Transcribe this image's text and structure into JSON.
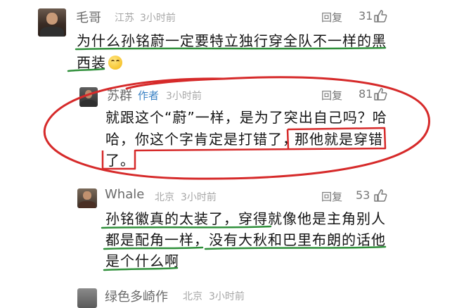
{
  "comments": [
    {
      "username": "毛哥",
      "location": "江苏",
      "time": "3小时前",
      "reply_label": "回复",
      "likes": "31",
      "text_lines": [
        "为什么孙铭蔚一定要特立独行穿全队不一样的黑",
        "西装"
      ],
      "emoji": "upside-down-relieved-face"
    },
    {
      "username": "苏群",
      "author_badge": "作者",
      "time": "3小时前",
      "reply_label": "回复",
      "likes": "81",
      "text_lines": [
        "就跟这个“蔚”一样，是为了突出自己吗？哈",
        "哈，你这个字肯定是打错了，",
        "那他就是穿错",
        "了。"
      ]
    },
    {
      "username": "Whale",
      "location": "北京",
      "time": "3小时前",
      "reply_label": "回复",
      "likes": "53",
      "text_lines": [
        "孙铭徽真的太装了，穿得就像他是主角别人",
        "都是配角一样，没有大秋和巴里布朗的话他",
        "是个什么啊"
      ]
    },
    {
      "username": "绿色多崎作",
      "location": "北京",
      "time": "3小时前"
    }
  ],
  "annotation_colors": {
    "underline": "#2f8f3a",
    "circle": "#d62a2a",
    "box": "#d62a2a"
  },
  "icons": {
    "like": "thumbs-up-icon"
  }
}
